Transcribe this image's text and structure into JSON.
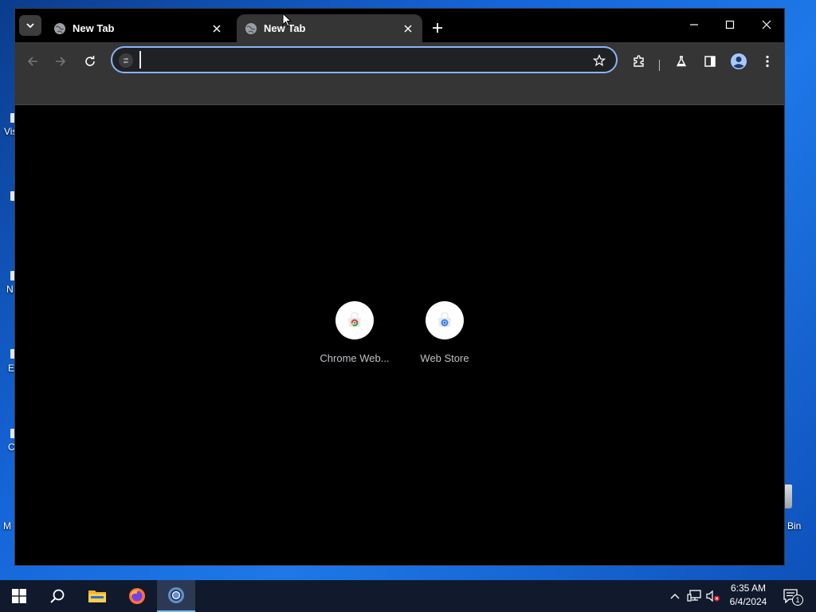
{
  "desktop": {
    "partial_labels": [
      "Vis",
      "N",
      "E",
      "C",
      "M"
    ],
    "recycle_bin_label": "Bin"
  },
  "browser": {
    "tabs": [
      {
        "title": "New Tab",
        "active": false
      },
      {
        "title": "New Tab",
        "active": true
      }
    ],
    "omnibox": {
      "value": "",
      "placeholder": ""
    },
    "shortcuts": [
      {
        "label": "Chrome Web...",
        "icon": "chrome-web-store-icon"
      },
      {
        "label": "Web Store",
        "icon": "web-store-icon"
      }
    ],
    "colors": {
      "accent": "#8ab4f8",
      "toolbar": "#353535",
      "tabstrip": "#000000"
    }
  },
  "taskbar": {
    "apps": [
      "start-icon",
      "search-icon",
      "file-explorer-icon",
      "firefox-icon",
      "chrome-icon"
    ],
    "active_app": "chrome-icon",
    "clock": {
      "time": "6:35 AM",
      "date": "6/4/2024"
    },
    "notification_count": "1"
  }
}
